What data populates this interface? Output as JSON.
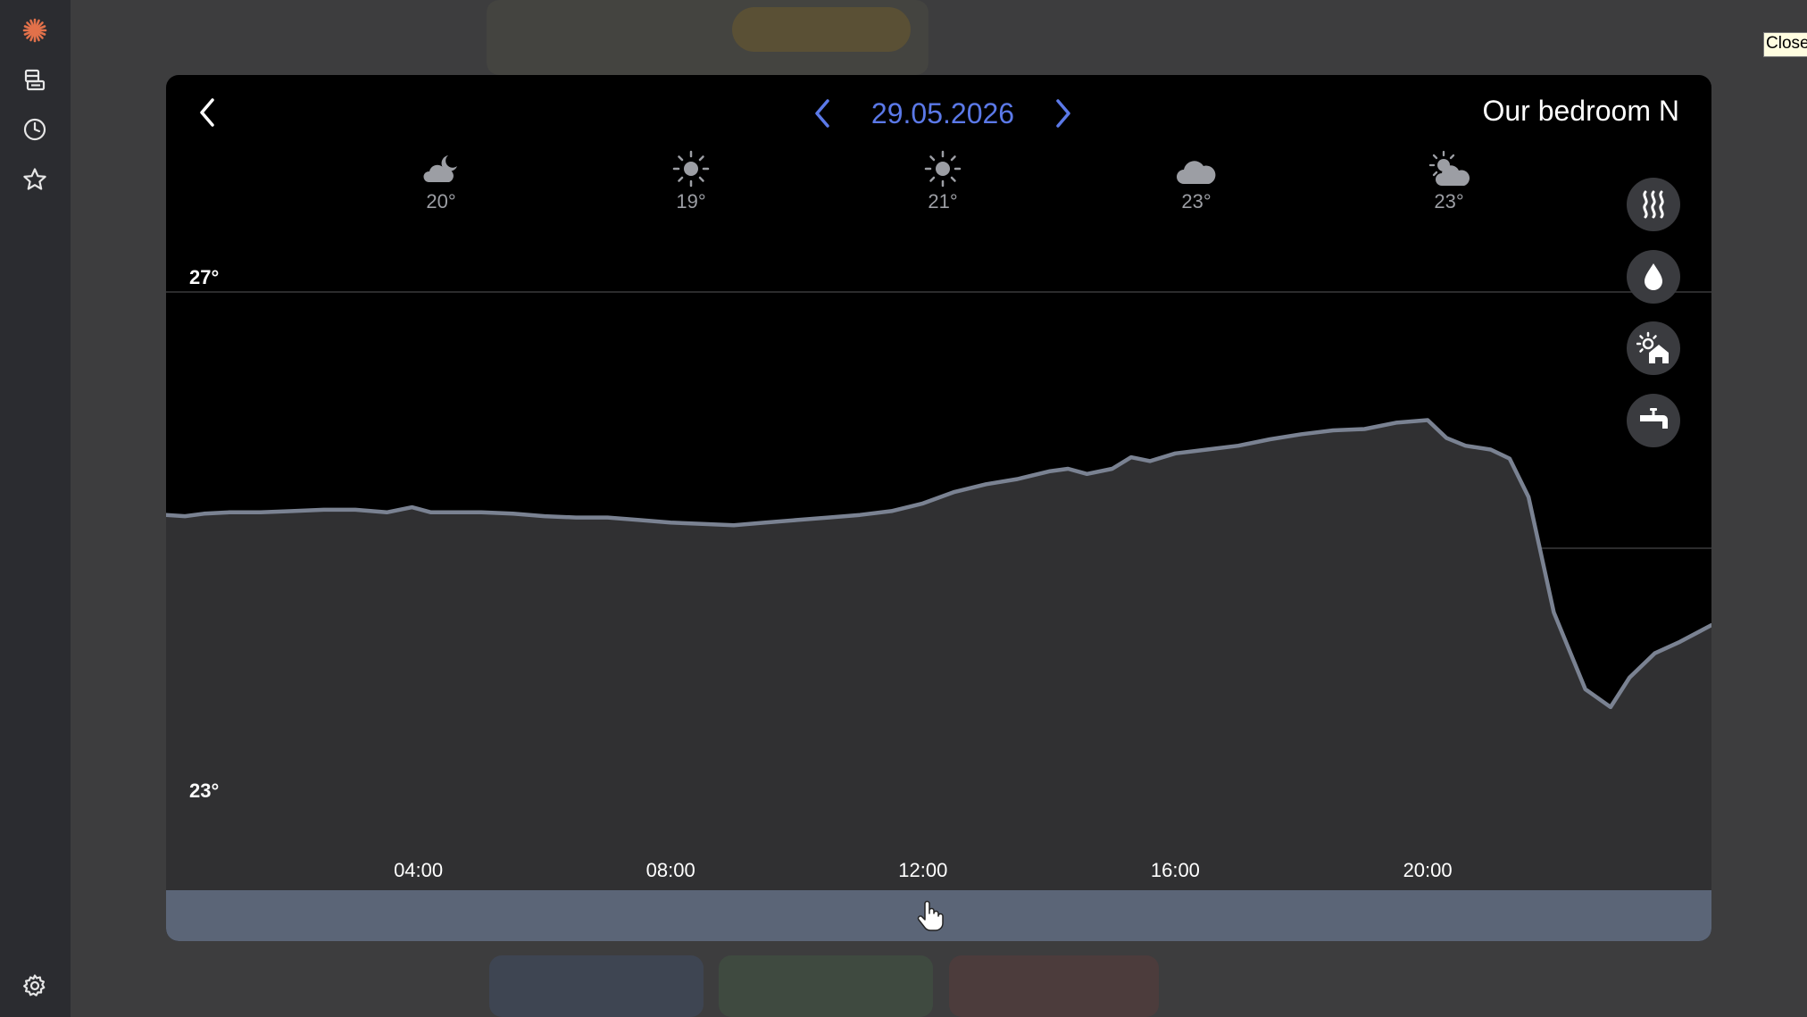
{
  "app": {
    "close_label": "Close"
  },
  "sidebar": {
    "items": [
      {
        "name": "logo",
        "icon": "sun-burst-icon",
        "accent": "#e2714a"
      },
      {
        "name": "devices",
        "icon": "devices-icon"
      },
      {
        "name": "history",
        "icon": "clock-icon"
      },
      {
        "name": "favorites",
        "icon": "star-icon"
      },
      {
        "name": "settings",
        "icon": "gear-icon"
      }
    ]
  },
  "header": {
    "date": "29.05.2026",
    "room": "Our bedroom N",
    "accent": "#5b79e8"
  },
  "forecast": [
    {
      "time": "04:00",
      "icon": "moon-cloud-icon",
      "temp": "20°"
    },
    {
      "time": "08:00",
      "icon": "sun-icon",
      "temp": "19°"
    },
    {
      "time": "12:00",
      "icon": "sun-icon",
      "temp": "21°"
    },
    {
      "time": "16:00",
      "icon": "cloud-icon",
      "temp": "23°"
    },
    {
      "time": "20:00",
      "icon": "sun-cloud-icon",
      "temp": "23°"
    }
  ],
  "modes": [
    {
      "name": "heating",
      "icon": "heat-waves-icon"
    },
    {
      "name": "humidity",
      "icon": "water-drop-icon"
    },
    {
      "name": "outdoor",
      "icon": "sun-house-icon"
    },
    {
      "name": "hot-water",
      "icon": "faucet-icon"
    }
  ],
  "chart_data": {
    "type": "area",
    "xlabel": "",
    "ylabel": "",
    "x_unit": "hour of day",
    "xlim": [
      0,
      24.5
    ],
    "ylim": [
      23,
      27
    ],
    "y_tick_labels": [
      "27°",
      "23°"
    ],
    "x_ticks": [
      {
        "value": 4,
        "label": "04:00"
      },
      {
        "value": 8,
        "label": "08:00"
      },
      {
        "value": 12,
        "label": "12:00"
      },
      {
        "value": 16,
        "label": "16:00"
      },
      {
        "value": 20,
        "label": "20:00"
      }
    ],
    "grid": "horizontal",
    "line_color": "#7a8292",
    "fill_color": "#303032",
    "series": [
      {
        "x": [
          0,
          0.3,
          0.6,
          1.0,
          1.5,
          2.0,
          2.5,
          3.0,
          3.5,
          3.9,
          4.2,
          4.5,
          5.0,
          5.5,
          6.0,
          6.5,
          7.0,
          7.5,
          8.0,
          8.5,
          9.0,
          9.5,
          10.0,
          10.5,
          11.0,
          11.5,
          12.0,
          12.5,
          13.0,
          13.5,
          14.0,
          14.3,
          14.6,
          15.0,
          15.3,
          15.6,
          16.0,
          16.5,
          17.0,
          17.5,
          18.0,
          18.5,
          19.0,
          19.5,
          20.0,
          20.3,
          20.6,
          21.0,
          21.3,
          21.6,
          22.0,
          22.5,
          22.9,
          23.2,
          23.6,
          24.0,
          24.5
        ],
        "y": [
          25.26,
          25.25,
          25.27,
          25.28,
          25.28,
          25.29,
          25.3,
          25.3,
          25.28,
          25.32,
          25.28,
          25.28,
          25.28,
          25.27,
          25.25,
          25.24,
          25.24,
          25.22,
          25.2,
          25.19,
          25.18,
          25.2,
          25.22,
          25.24,
          25.26,
          25.29,
          25.35,
          25.44,
          25.5,
          25.54,
          25.6,
          25.62,
          25.58,
          25.62,
          25.71,
          25.68,
          25.74,
          25.77,
          25.8,
          25.85,
          25.89,
          25.92,
          25.93,
          25.98,
          26.0,
          25.86,
          25.8,
          25.77,
          25.7,
          25.4,
          24.5,
          23.9,
          23.76,
          23.99,
          24.18,
          24.27,
          24.4
        ]
      }
    ]
  }
}
